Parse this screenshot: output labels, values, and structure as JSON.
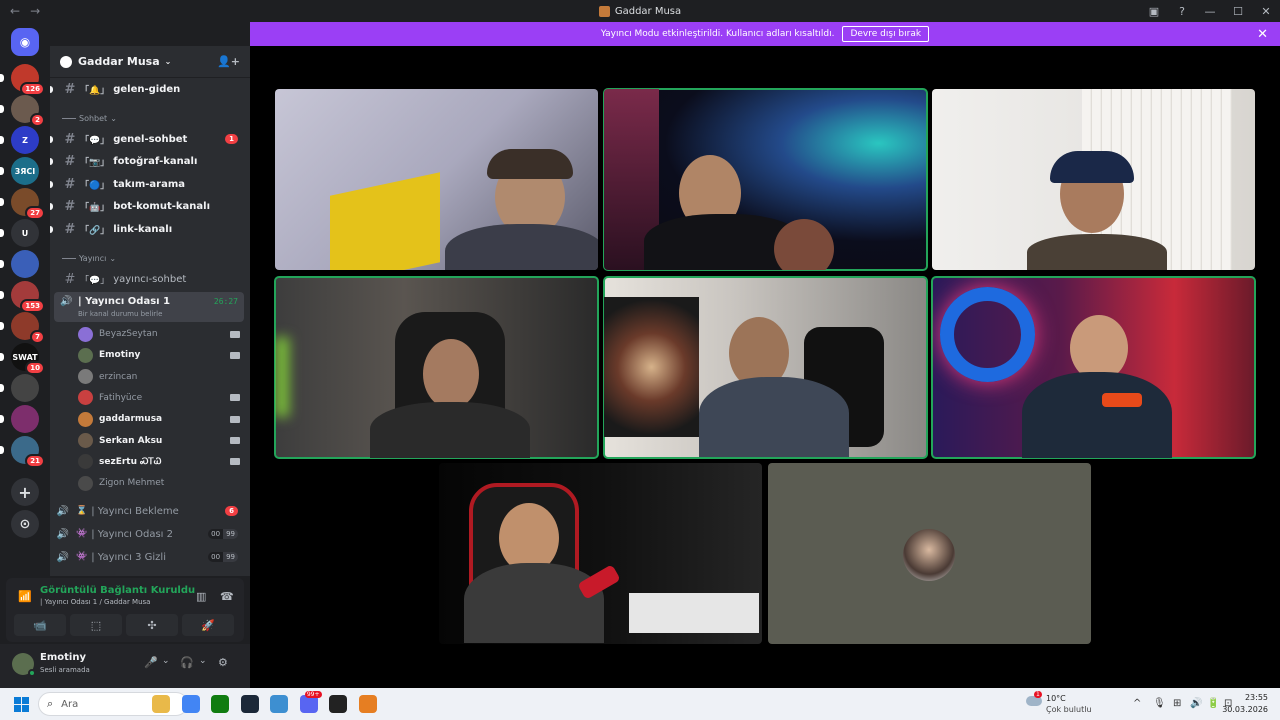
{
  "window": {
    "title": "Gaddar Musa",
    "nav_back": "←",
    "nav_forward": "→",
    "controls": [
      "▣",
      "?",
      "—",
      "☐",
      "✕"
    ]
  },
  "banner": {
    "text": "Yayıncı Modu etkinleştirildi. Kullanıcı adları kısaltıldı.",
    "button": "Devre dışı bırak",
    "close": "✕"
  },
  "guilds": [
    {
      "letter": "",
      "badge": "126",
      "color": "#c0392b"
    },
    {
      "letter": "",
      "badge": "2",
      "color": "#6b5a4e"
    },
    {
      "letter": "Z",
      "badge": "",
      "color": "#2d3cc7"
    },
    {
      "letter": "3ЯCI",
      "badge": "",
      "color": "#1c6e8a"
    },
    {
      "letter": "",
      "badge": "27",
      "color": "#7a4b2a"
    },
    {
      "letter": "U",
      "badge": "",
      "color": "#313338"
    },
    {
      "letter": "",
      "badge": "",
      "color": "#3a5fb8"
    },
    {
      "letter": "",
      "badge": "153",
      "color": "#a33b3b"
    },
    {
      "letter": "",
      "badge": "7",
      "color": "#8e3a2a"
    },
    {
      "letter": "SWAT",
      "badge": "10",
      "color": "#111111"
    },
    {
      "letter": "",
      "badge": "",
      "color": "#444444"
    },
    {
      "letter": "",
      "badge": "",
      "color": "#7d2e6c"
    },
    {
      "letter": "",
      "badge": "21",
      "color": "#3b6a8a"
    }
  ],
  "guild_actions": {
    "add": "+",
    "explore": "⊙",
    "home": "◉"
  },
  "server": {
    "name": "Gaddar Musa",
    "chevron": "⌄",
    "invite_icon": "👤+"
  },
  "channels": {
    "top": {
      "emoji": "「🔔」",
      "name": "gelen-giden"
    },
    "category_sohbet": "Sohbet",
    "sohbet": [
      {
        "emoji": "「💬」",
        "name": "genel-sohbet",
        "mention": "1",
        "unread": true
      },
      {
        "emoji": "「📷」",
        "name": "fotoğraf-kanalı",
        "mention": "",
        "unread": true
      },
      {
        "emoji": "「🔵」",
        "name": "takım-arama",
        "mention": "",
        "unread": true
      },
      {
        "emoji": "「🤖」",
        "name": "bot-komut-kanalı",
        "mention": "",
        "unread": true
      },
      {
        "emoji": "「🔗」",
        "name": "link-kanalı",
        "mention": "",
        "unread": true
      }
    ],
    "category_yayinci": "Yayıncı",
    "yayinci_text": {
      "emoji": "「💬」",
      "name": "yayıncı-sohbet"
    },
    "active_voice": {
      "name": "| Yayıncı Odası 1",
      "timer": "26:27",
      "status": "Bir kanal durumu belirle"
    },
    "members": [
      {
        "name": "BeyazSeytan",
        "live": false,
        "cam": true,
        "color": "#8a6fd6"
      },
      {
        "name": "Emotiny",
        "live": true,
        "cam": true,
        "color": "#5b6e4f"
      },
      {
        "name": "erzincan",
        "live": false,
        "cam": false,
        "color": "#7a7a7a"
      },
      {
        "name": "Fatihyüce",
        "live": false,
        "cam": true,
        "color": "#c94040"
      },
      {
        "name": "gaddarmusa",
        "live": true,
        "cam": true,
        "color": "#c47a3a"
      },
      {
        "name": "Serkan Aksu",
        "live": true,
        "cam": true,
        "color": "#6a5a4a"
      },
      {
        "name": "sezErtu ᏍᎢᏇ",
        "live": true,
        "cam": true,
        "color": "#3a3a3a"
      },
      {
        "name": "Zigon Mehmet",
        "live": false,
        "cam": false,
        "color": "#4a4a4a"
      }
    ],
    "other_voice": [
      {
        "emoji": "⌛",
        "name": "| Yayıncı Bekleme",
        "mention": "6",
        "counts": [
          "",
          ""
        ]
      },
      {
        "emoji": "👾",
        "name": "| Yayıncı Odası 2",
        "mention": "",
        "counts": [
          "00",
          "99"
        ]
      },
      {
        "emoji": "👾",
        "name": "| Yayıncı 3 Gizli",
        "mention": "",
        "counts": [
          "00",
          "99"
        ]
      }
    ]
  },
  "voice_panel": {
    "status": "Görüntülü Bağlantı Kuruldu",
    "channel": "| Yayıncı Odası 1 / Gaddar Musa",
    "buttons": [
      "📹",
      "⬚",
      "✣",
      "🚀"
    ]
  },
  "user": {
    "name": "Emotiny",
    "status": "Sesli aramada",
    "controls": [
      "🎤",
      "⌄",
      "🎧",
      "⌄",
      "⚙"
    ]
  },
  "taskbar": {
    "search_placeholder": "Ara",
    "apps": [
      {
        "color": "#e9b949",
        "badge": ""
      },
      {
        "color": "#4285f4",
        "badge": ""
      },
      {
        "color": "#107c10",
        "badge": ""
      },
      {
        "color": "#1b2838",
        "badge": ""
      },
      {
        "color": "#3d8fd1",
        "badge": ""
      },
      {
        "color": "#5865f2",
        "badge": "99+"
      },
      {
        "color": "#222222",
        "badge": ""
      },
      {
        "color": "#e67e22",
        "badge": ""
      }
    ],
    "weather_badge": "1",
    "temp": "10°C",
    "weather": "Çok bulutlu",
    "tray": [
      "^",
      "🎙",
      "⊞",
      "🔊",
      "🔋",
      "⊡"
    ],
    "time": "23:55",
    "date": "30.03.2026"
  },
  "colors": {
    "accent": "#5865f2",
    "banner": "#9b3ff5",
    "speaking": "#23a55a",
    "mention": "#f23f43"
  }
}
